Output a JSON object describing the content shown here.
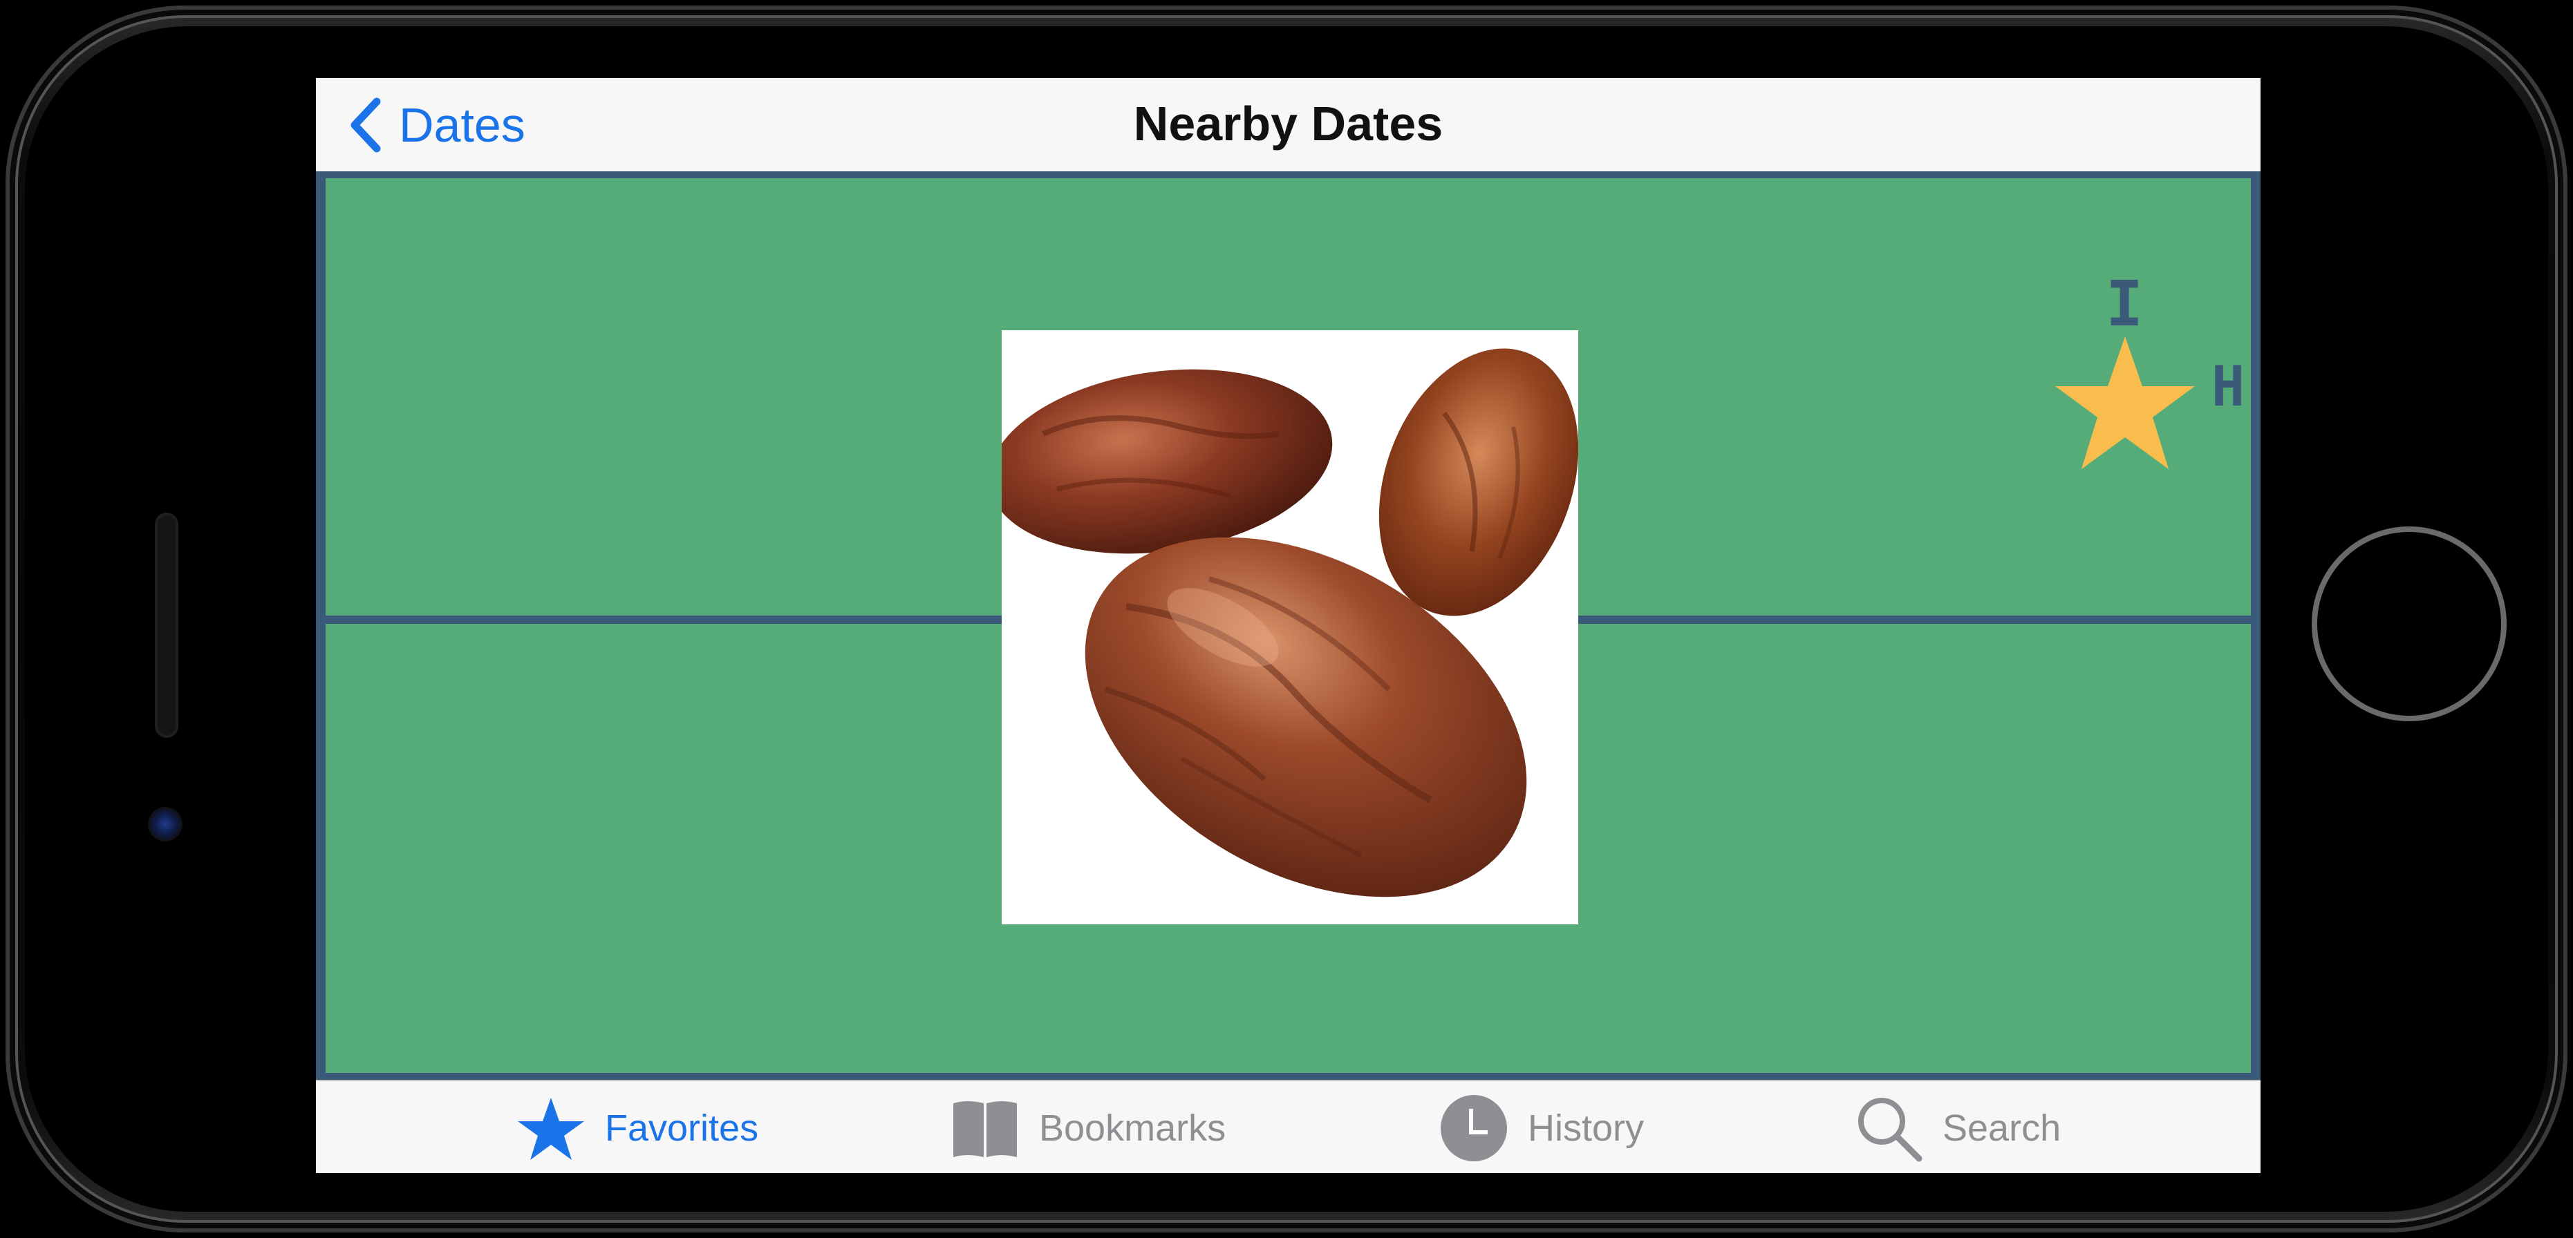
{
  "nav": {
    "back_label": "Dates",
    "title": "Nearby Dates"
  },
  "map": {
    "marker_labels": {
      "top": "I",
      "right": "H"
    },
    "marker_icon": "star-icon",
    "photo_subject": "dates-photo"
  },
  "tabbar": {
    "items": [
      {
        "label": "Favorites",
        "icon": "star-icon",
        "active": true
      },
      {
        "label": "Bookmarks",
        "icon": "book-icon",
        "active": false
      },
      {
        "label": "History",
        "icon": "clock-icon",
        "active": false
      },
      {
        "label": "Search",
        "icon": "search-icon",
        "active": false
      }
    ]
  },
  "colors": {
    "accent": "#1a73e8",
    "map_green": "#55ac78",
    "border_blue": "#3b5a7a",
    "star_gold": "#f9bd4e",
    "inactive": "#8e8e93"
  }
}
